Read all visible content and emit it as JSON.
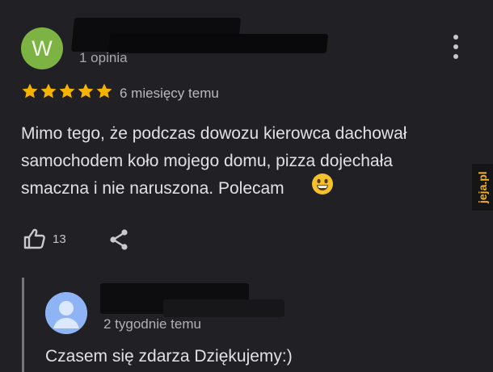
{
  "review": {
    "author_initial": "W",
    "author_reviews": "1 opinia",
    "rating_stars": 5,
    "date": "6 miesięcy temu",
    "text": "Mimo tego, że podczas dowozu kierowca dachował\nsamochodem koło mojego domu, pizza dojechała\nsmaczna i nie naruszona. Polecam",
    "likes": "13"
  },
  "owner_reply": {
    "date": "2 tygodnie temu",
    "text": "Czasem się zdarza Dziękujemy:)"
  },
  "watermark": "jeja.pl",
  "colors": {
    "background": "#212125",
    "avatar_green": "#7cb342",
    "star_yellow": "#f6b400",
    "owner_avatar_blue": "#8fb4f5",
    "watermark": "#f4b21c"
  },
  "icons": {
    "more": "more-vertical-icon",
    "like": "thumb-up-icon",
    "share": "share-icon",
    "emoji": "smiling-face-emoji-icon"
  }
}
